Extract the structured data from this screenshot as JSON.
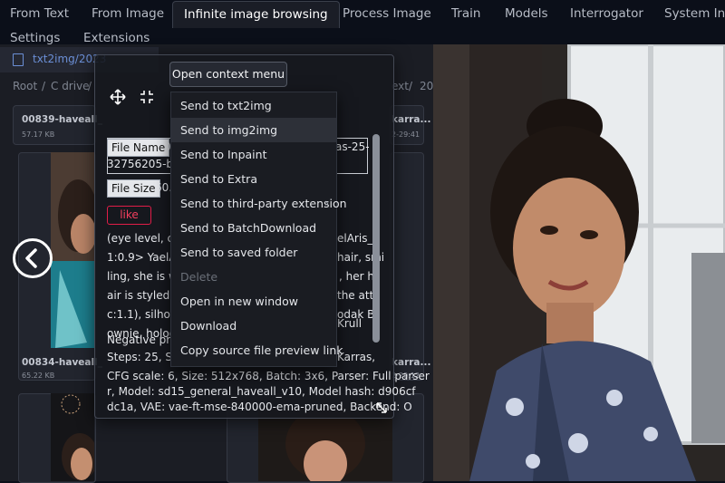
{
  "tabs": [
    {
      "label": "From Text"
    },
    {
      "label": "From Image"
    },
    {
      "label": "Infinite image browsing"
    },
    {
      "label": "Process Image"
    },
    {
      "label": "Train"
    },
    {
      "label": "Models"
    },
    {
      "label": "Interrogator"
    },
    {
      "label": "System Inf"
    }
  ],
  "subtabs": [
    {
      "label": "Settings"
    },
    {
      "label": "Extensions"
    }
  ],
  "path_tab": {
    "label": "txt2img/2023"
  },
  "breadcrumb": {
    "root": "Root",
    "sep": "/",
    "drive": "C drive",
    "right_text": "ext",
    "right_year": "202"
  },
  "cards": [
    {
      "title": "00839-haveall_",
      "size": "57.17 KB"
    },
    {
      "title": "karra...",
      "size": "2-29:41"
    },
    {
      "title": "00834-haveall_",
      "size": "65.22 KB"
    },
    {
      "title": "karra...",
      "size": "2-29:12"
    }
  ],
  "overlay": {
    "context_button": "Open context menu",
    "file_name_label": "File Name",
    "file_name_value": "0",
    "file_name_right": "as-25-",
    "file_name_line2": "32756205-b2",
    "file_size_label": "File Size",
    "file_size_value": "60.",
    "like_label": "like",
    "prompt_lines": [
      "(eye level, clo",
      "1:0.9> YaelAri",
      "ling, she is we",
      "air is styled as",
      "c:1.1), silhoue",
      "ownie, hologr",
      "Negative prom",
      "Steps: 25, See"
    ],
    "prompt_right": [
      "elAris_v",
      "hair, smi",
      ", her h",
      "the atti",
      "odak Br",
      "Krull",
      "",
      "Karras,"
    ],
    "params_lines": [
      "CFG scale: 6, Size: 512x768, Batch: 3x6, Parser: Full parser",
      "r, Model: sd15_general_haveall_v10, Model hash: d906cf",
      "dc1a, VAE: vae-ft-mse-840000-ema-pruned, Backend: O"
    ]
  },
  "context_menu": {
    "items": [
      {
        "label": "Send to txt2img"
      },
      {
        "label": "Send to img2img"
      },
      {
        "label": "Send to Inpaint"
      },
      {
        "label": "Send to Extra"
      },
      {
        "label": "Send to third-party extension"
      },
      {
        "label": "Send to BatchDownload"
      },
      {
        "label": "Send to saved folder"
      },
      {
        "label": "Delete"
      },
      {
        "label": "Open in new window"
      },
      {
        "label": "Download"
      },
      {
        "label": "Copy source file preview link"
      }
    ]
  },
  "icons": {
    "move": "move-icon",
    "fullscreen": "fullscreen-icon",
    "prev": "arrow-left-circle-icon",
    "resize": "resize-handle-icon",
    "file": "file-icon"
  },
  "colors": {
    "accent": "#e11d48",
    "link": "#6b8fd6"
  }
}
